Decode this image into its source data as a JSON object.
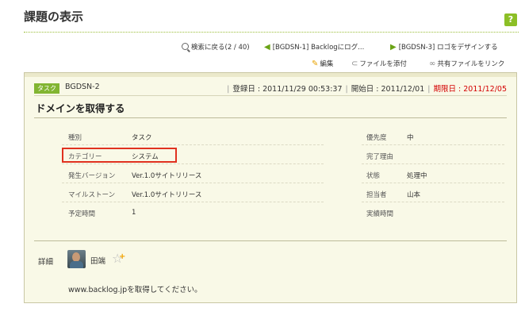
{
  "header": {
    "title": "課題の表示",
    "help_label": "?"
  },
  "nav": {
    "back_to_search": "検索に戻る(2 / 40)",
    "prev_issue": "[BGDSN-1] Backlogにログ...",
    "next_issue": "[BGDSN-3] ロゴをデザインする"
  },
  "actions": {
    "edit": "編集",
    "attach_file": "ファイルを添付",
    "link_shared_file": "共有ファイルをリンク"
  },
  "issue": {
    "type_badge": "タスク",
    "key": "BGDSN-2",
    "registered_label": "登録日",
    "registered": "2011/11/29 00:53:37",
    "start_label": "開始日",
    "start": "2011/12/01",
    "due_label": "期限日",
    "due": "2011/12/05",
    "summary": "ドメインを取得する",
    "left_props": [
      {
        "label": "種別",
        "value": "タスク"
      },
      {
        "label": "カテゴリー",
        "value": "システム"
      },
      {
        "label": "発生バージョン",
        "value": "Ver.1.0サイトリリース"
      },
      {
        "label": "マイルストーン",
        "value": "Ver.1.0サイトリリース"
      },
      {
        "label": "予定時間",
        "value": "1"
      }
    ],
    "right_props": [
      {
        "label": "優先度",
        "value": "中"
      },
      {
        "label": "完了理由",
        "value": ""
      },
      {
        "label": "状態",
        "value": "処理中"
      },
      {
        "label": "担当者",
        "value": "山本"
      },
      {
        "label": "実績時間",
        "value": ""
      }
    ],
    "detail_label": "詳細",
    "reporter": "田端",
    "description": "www.backlog.jpを取得してください。"
  },
  "colors": {
    "accent": "#82b531",
    "due": "#d40000",
    "highlight": "#e0311f",
    "panel_bg": "#f9f9e7"
  }
}
